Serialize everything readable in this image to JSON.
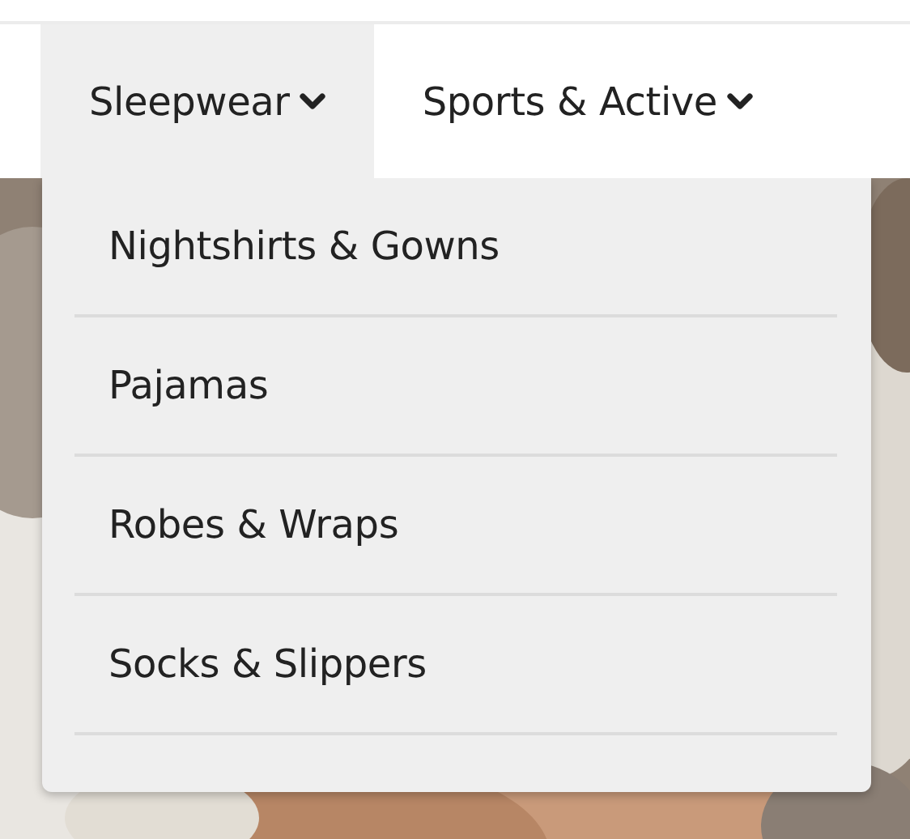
{
  "nav": {
    "items": [
      {
        "label": "Sleepwear",
        "expanded": true
      },
      {
        "label": "Sports & Active",
        "expanded": false
      }
    ]
  },
  "dropdown": {
    "items": [
      {
        "label": "Nightshirts & Gowns"
      },
      {
        "label": "Pajamas"
      },
      {
        "label": "Robes & Wraps"
      },
      {
        "label": "Socks & Slippers"
      }
    ]
  }
}
